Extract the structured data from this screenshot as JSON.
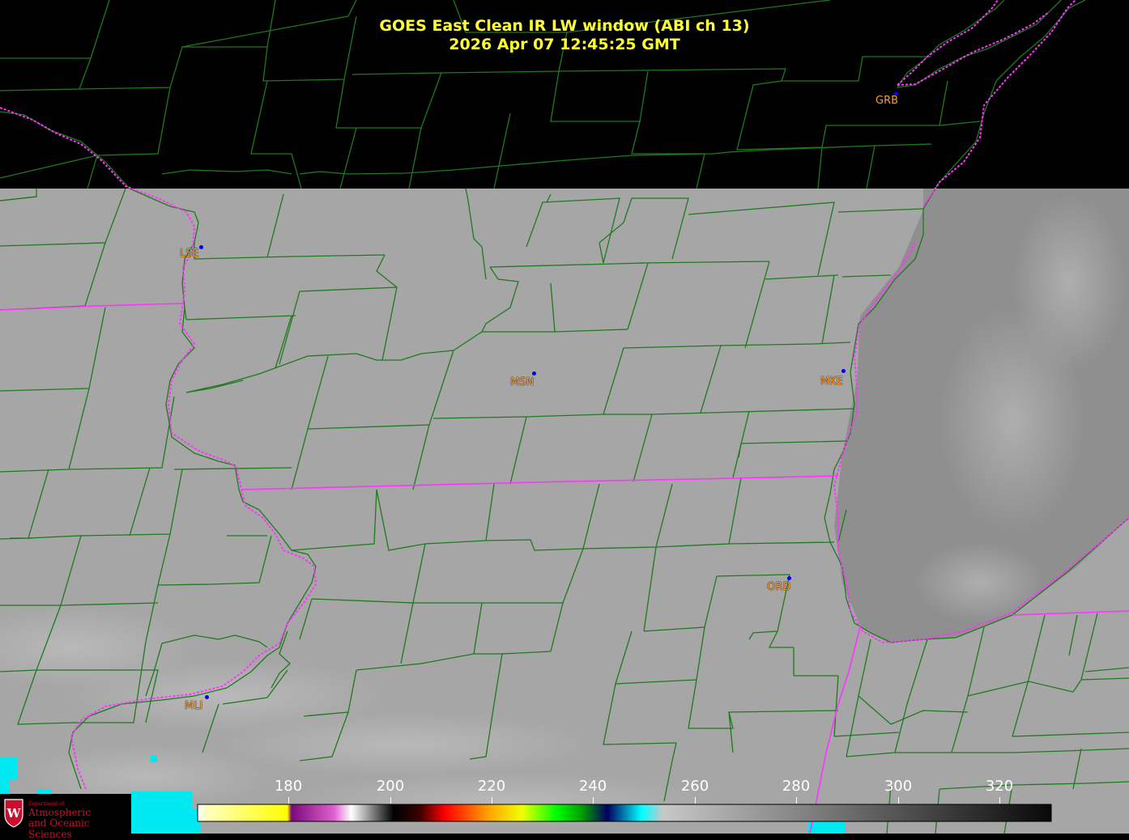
{
  "title": {
    "line1": "GOES East Clean IR LW window (ABI ch 13)",
    "line2": "2026 Apr 07  12:45:25 GMT"
  },
  "stations": [
    {
      "id": "GRB"
    },
    {
      "id": "LSE"
    },
    {
      "id": "MSN"
    },
    {
      "id": "MKE"
    },
    {
      "id": "ORD"
    },
    {
      "id": "MLI"
    }
  ],
  "colorbar": {
    "ticks": [
      "180",
      "200",
      "220",
      "240",
      "260",
      "280",
      "300",
      "320"
    ]
  },
  "logo": {
    "line1": "Department of",
    "line2": "Atmospheric",
    "line3": "and Oceanic Sciences"
  },
  "colors": {
    "county_lines": "#1e7a1e",
    "state_lines": "#ff33ff",
    "title_text": "#ffff33",
    "station_label": "#ff9a2e",
    "station_dot": "#0000ee",
    "land_gray": "#a6a6a6",
    "lake_gray": "#8f8f8f",
    "logo_red": "#c8102e"
  }
}
